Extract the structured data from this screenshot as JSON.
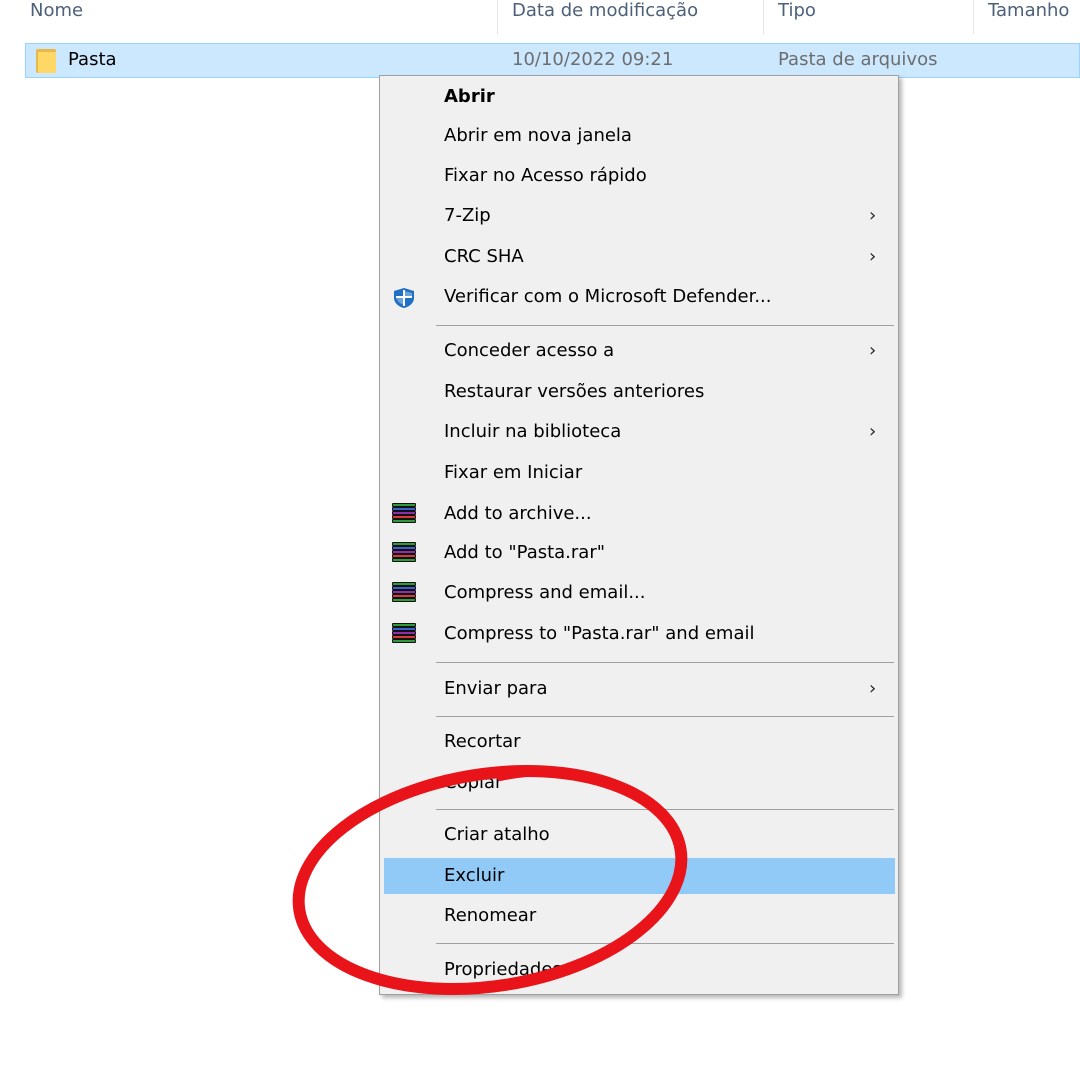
{
  "columns": {
    "name": "Nome",
    "modified": "Data de modificação",
    "type": "Tipo",
    "size": "Tamanho"
  },
  "file_row": {
    "icon": "folder-icon",
    "name": "Pasta",
    "modified": "10/10/2022 09:21",
    "type": "Pasta de arquivos"
  },
  "menu": {
    "items": [
      {
        "label": "Abrir",
        "bold": true
      },
      {
        "label": "Abrir em nova janela"
      },
      {
        "label": "Fixar no Acesso rápido"
      },
      {
        "label": "7-Zip",
        "submenu": true
      },
      {
        "label": "CRC SHA",
        "submenu": true
      },
      {
        "label": "Verificar com o Microsoft Defender...",
        "icon": "defender-shield-icon"
      },
      {
        "label": "Conceder acesso a",
        "submenu": true
      },
      {
        "label": "Restaurar versões anteriores"
      },
      {
        "label": "Incluir na biblioteca",
        "submenu": true
      },
      {
        "label": "Fixar em Iniciar"
      },
      {
        "label": "Add to archive...",
        "icon": "winrar-icon"
      },
      {
        "label": "Add to \"Pasta.rar\"",
        "icon": "winrar-icon"
      },
      {
        "label": "Compress and email...",
        "icon": "winrar-icon"
      },
      {
        "label": "Compress to \"Pasta.rar\" and email",
        "icon": "winrar-icon"
      },
      {
        "label": "Enviar para",
        "submenu": true
      },
      {
        "label": "Recortar"
      },
      {
        "label": "Copiar"
      },
      {
        "label": "Criar atalho"
      },
      {
        "label": "Excluir",
        "highlighted": true
      },
      {
        "label": "Renomear"
      },
      {
        "label": "Propriedades"
      }
    ]
  },
  "colors": {
    "selection": "#cce8ff",
    "menu_hover": "#91c9f7",
    "annotation_red": "#e8141a"
  }
}
